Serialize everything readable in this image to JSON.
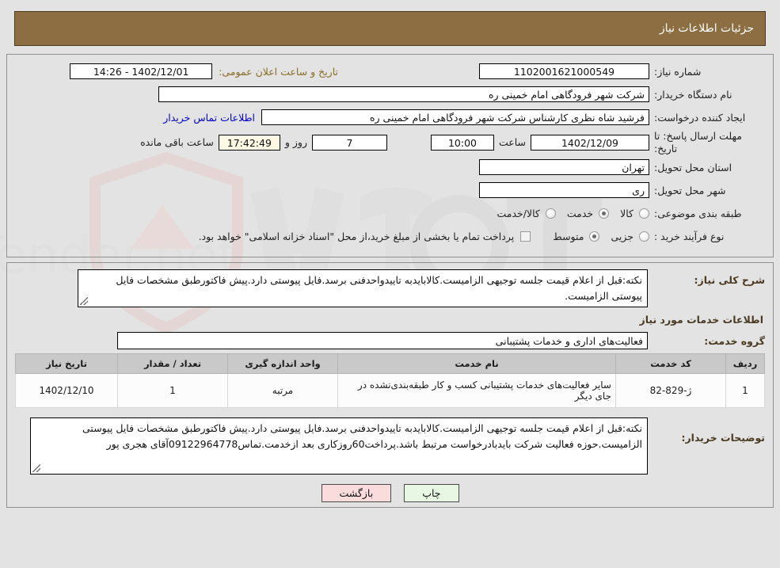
{
  "header": {
    "title": "جزئیات اطلاعات نیاز",
    "bar_color": "#8d6e43"
  },
  "summary": {
    "need_number_label": "شماره نیاز:",
    "need_number_value": "1102001621000549",
    "announce_label": "تاریخ و ساعت اعلان عمومی:",
    "announce_value": "1402/12/01 - 14:26",
    "buyer_org_label": "نام دستگاه خریدار:",
    "buyer_org_value": "شرکت شهر فرودگاهی امام خمینی  ره",
    "creator_label": "ایجاد کننده درخواست:",
    "creator_value": "فرشید شاه نظری کارشناس شرکت شهر فرودگاهی امام خمینی  ره",
    "contact_link": "اطلاعات تماس خریدار",
    "deadline_label": "مهلت ارسال پاسخ: تا تاریخ:",
    "deadline_date": "1402/12/09",
    "time_label": "ساعت",
    "deadline_time": "10:00",
    "days_value": "7",
    "days_label": "روز و",
    "countdown_value": "17:42:49",
    "countdown_label": "ساعت باقی مانده",
    "province_label": "استان محل تحویل:",
    "province_value": "تهران",
    "city_label": "شهر محل تحویل:",
    "city_value": "ری",
    "category_label": "طبقه بندی موضوعی:",
    "category_options": [
      "کالا",
      "خدمت",
      "کالا/خدمت"
    ],
    "category_selected": "خدمت",
    "process_label": "نوع فرآیند خرید :",
    "process_options": [
      "جزیی",
      "متوسط"
    ],
    "process_selected": "متوسط",
    "payment_note": "پرداخت تمام یا بخشی از مبلغ خرید،از محل \"اسناد خزانه اسلامی\" خواهد بود.",
    "payment_checked": false
  },
  "description": {
    "label": "شرح کلی نیاز:",
    "value": "نکته:قبل از اعلام قیمت جلسه توجیهی الزامیست.کالابایدبه تاییدواحدفنی برسد.فایل پیوستی دارد.پیش فاکتورطبق مشخصات فایل پیوستی الزامیست."
  },
  "services": {
    "section_title": "اطلاعات خدمات مورد نیاز",
    "group_label": "گروه خدمت:",
    "group_value": "فعالیت‌های اداری و خدمات پشتیبانی",
    "columns": [
      "ردیف",
      "کد خدمت",
      "نام خدمت",
      "واحد اندازه گیری",
      "تعداد / مقدار",
      "تاریخ نیاز"
    ],
    "rows": [
      {
        "radif": "1",
        "code": "ژ-829-82",
        "name": "سایر فعالیت‌های خدمات پشتیبانی کسب و کار طبقه‌بندی‌نشده در جای دیگر",
        "unit": "مرتبه",
        "qty": "1",
        "date": "1402/12/10"
      }
    ]
  },
  "buyer_notes": {
    "label": "توضیحات خریدار:",
    "value": "نکته:قبل از اعلام قیمت جلسه توجیهی الزامیست.کالابایدبه تاییدواحدفنی برسد.فایل پیوستی دارد.پیش فاکتورطبق مشخصات فایل پیوستی الزامیست.حوزه فعالیت شرکت بایدبادرخواست مرتبط باشد.پرداخت60روزکاری بعد ازخدمت.تماس09122964778آقای هجری پور"
  },
  "footer": {
    "print_label": "چاپ",
    "back_label": "بازگشت"
  },
  "watermark": {
    "text": "AriaTender.net"
  }
}
